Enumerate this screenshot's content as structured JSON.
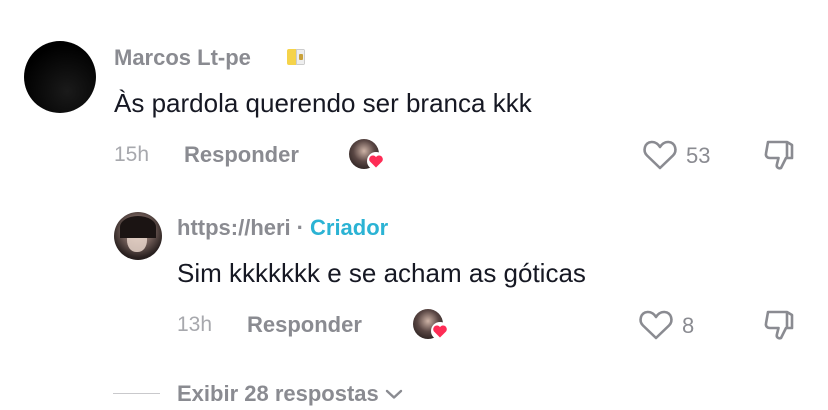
{
  "comment": {
    "username": "Marcos Lt-pe",
    "flag_icon": "flag-vatican-icon",
    "text": "Às pardola querendo ser branca kkk",
    "time": "15h",
    "reply_label": "Responder",
    "like_count": "53"
  },
  "reply": {
    "username": "https://heri",
    "separator": "·",
    "badge": "Criador",
    "text": "Sim kkkkkkk e se acham as góticas",
    "time": "13h",
    "reply_label": "Responder",
    "like_count": "8"
  },
  "view_more": {
    "label": "Exibir 28 respostas"
  },
  "colors": {
    "creator_badge": "#2bb3d4",
    "heart_badge": "#fe2c55",
    "muted_text": "#8a8b91"
  }
}
